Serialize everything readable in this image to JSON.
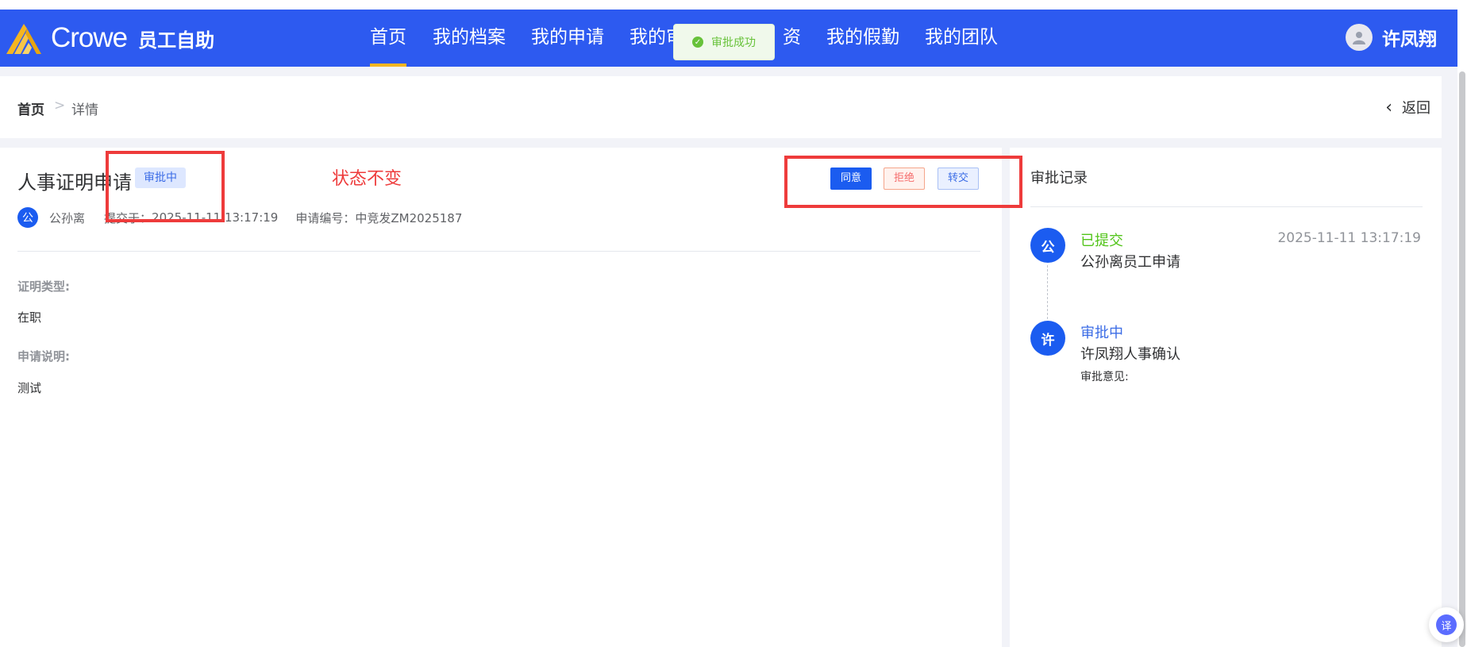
{
  "header": {
    "logo_text": "Crowe",
    "app_name": "员工自助",
    "nav": [
      {
        "label": "首页"
      },
      {
        "label": "我的档案"
      },
      {
        "label": "我的申请"
      },
      {
        "label": "我的审"
      },
      {
        "label": "资"
      },
      {
        "label": "我的假勤"
      },
      {
        "label": "我的团队"
      }
    ],
    "active_nav": "首页",
    "user_name": "许凤翔"
  },
  "toast": {
    "message": "审批成功",
    "type": "success"
  },
  "breadcrumb": {
    "home": "首页",
    "separator": ">",
    "current": "详情"
  },
  "back_label": "返回",
  "detail": {
    "title": "人事证明申请",
    "status": "审批中",
    "actions": {
      "agree": "同意",
      "reject": "拒绝",
      "transfer": "转交"
    },
    "applicant_avatar": "公",
    "applicant": "公孙离",
    "submitted_label": "提交于：",
    "submitted_at": "2025-11-11 13:17:19",
    "number_label": "申请编号：",
    "number": "中竞发ZM2025187",
    "fields": [
      {
        "label": "证明类型:",
        "value": "在职"
      },
      {
        "label": "申请说明:",
        "value": "测试"
      }
    ]
  },
  "records": {
    "title": "审批记录",
    "items": [
      {
        "avatar": "公",
        "status": "已提交",
        "status_color": "#52c41a",
        "desc": "公孙离员工申请",
        "time": "2025-11-11 13:17:19"
      },
      {
        "avatar": "许",
        "status": "审批中",
        "status_color": "#3b6ce6",
        "desc": "许凤翔人事确认",
        "comment_label": "审批意见:"
      }
    ]
  },
  "annotation": {
    "text": "状态不变",
    "color": "#ee3b3b"
  },
  "float_button": "译",
  "colors": {
    "primary": "#2d5af0",
    "accent": "#f5b520"
  }
}
